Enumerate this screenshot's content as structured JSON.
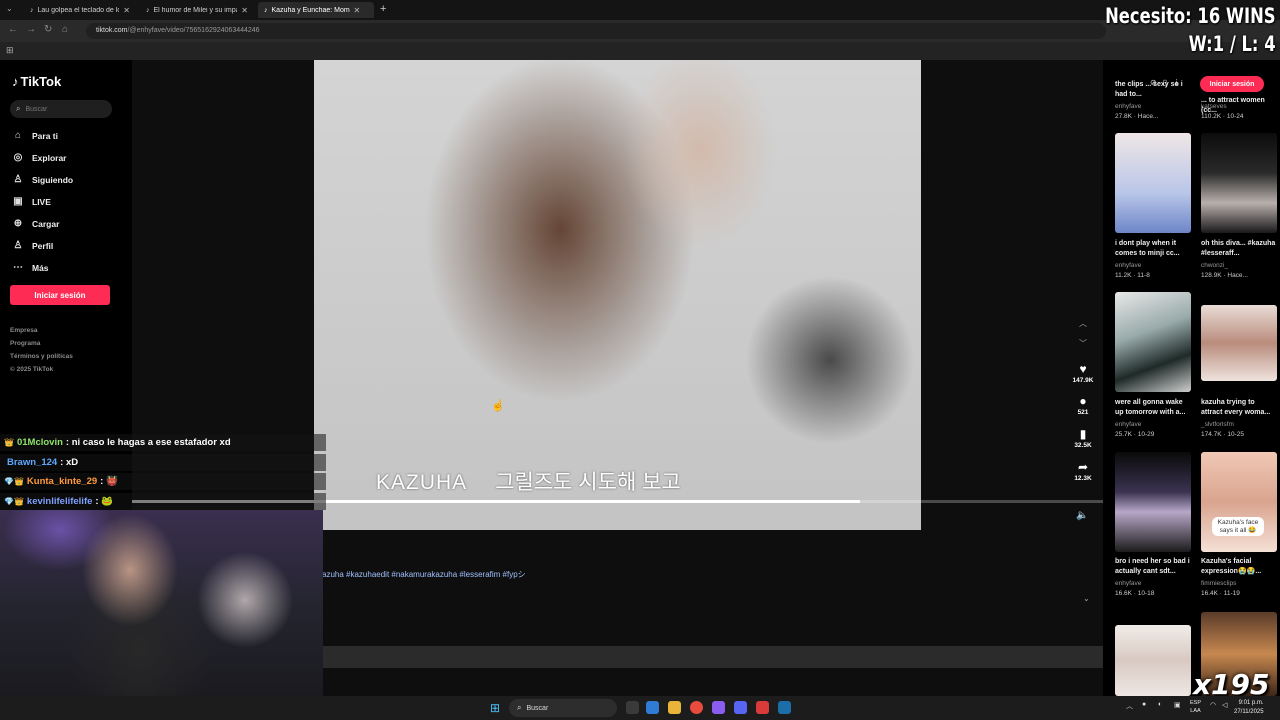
{
  "browser": {
    "tabs": [
      {
        "title": "Lau golpea el teclado de los lo"
      },
      {
        "title": "El humor de Milei y su impacto"
      },
      {
        "title": "Kazuha y Eunchae: Moment"
      }
    ],
    "new_tab": "+",
    "url_host": "tiktok.com",
    "url_path": "/@enhyfave/video/7565162924063444246"
  },
  "tiktok": {
    "logo": "TikTok",
    "search_placeholder": "Buscar",
    "nav": [
      {
        "label": "Para ti",
        "icon": "home-icon"
      },
      {
        "label": "Explorar",
        "icon": "compass-icon"
      },
      {
        "label": "Siguiendo",
        "icon": "following-icon"
      },
      {
        "label": "LIVE",
        "icon": "live-icon"
      },
      {
        "label": "Cargar",
        "icon": "upload-icon"
      },
      {
        "label": "Perfil",
        "icon": "profile-icon"
      },
      {
        "label": "Más",
        "icon": "more-icon"
      }
    ],
    "login": "Iniciar sesión",
    "footer": [
      "Empresa",
      "Programa",
      "Términos y políticas",
      "© 2025 TikTok"
    ]
  },
  "video": {
    "subtitle_name": "KAZUHA",
    "subtitle_korean": "그릴즈도 시도해 보고",
    "progress_fraction": 0.75,
    "likes": "147.9K",
    "comments": "521",
    "saves": "32.5K",
    "shares": "12.3K",
    "hashtags": "azuha #kazuhaedit #nakamurakazuha #lesserafim #fypシ"
  },
  "feed": {
    "login": "Iniciar sesión",
    "items": [
      {
        "caption": "the clips ... sexy so i had to...",
        "user": "enhyfave",
        "stats": "27.8K · Hace..."
      },
      {
        "caption": "... to attract women (cc...",
        "user": "katseves",
        "stats": "110.2K · 10-24"
      },
      {
        "caption": "i dont play when it comes to minji cc...",
        "user": "enhyfave",
        "stats": "11.2K · 11-8"
      },
      {
        "caption": "oh this diva... #kazuha #lesseraff...",
        "user": "chwonzi_",
        "stats": "128.9K · Hace..."
      },
      {
        "caption": "were all gonna wake up tomorrow with a...",
        "user": "enhyfave",
        "stats": "25.7K · 10-29"
      },
      {
        "caption": "kazuha trying to attract every woma...",
        "user": "_slvtforlsfm",
        "stats": "174.7K · 10-25"
      },
      {
        "caption": "bro i need her so bad i actually cant sdt...",
        "user": "enhyfave",
        "stats": "16.6K · 10-18"
      },
      {
        "caption": "Kazuha's facial expression😭😭...",
        "user": "fimmiesclips",
        "stats": "16.4K · 11-19"
      }
    ],
    "thumb_overlay": "Kazuha's face says it all 😂"
  },
  "stream": {
    "goal": "Necesito: 16 WINS",
    "record": "W:1 / L: 4",
    "multiplier": "x195",
    "chat": [
      {
        "badges": "👑",
        "user": "01Mclovin",
        "user_color": "#8fe36b",
        "message": ": ni caso le hagas a ese estafador xd"
      },
      {
        "badges": "",
        "user": "Brawn_124",
        "user_color": "#5fa8ff",
        "message": ": xD"
      },
      {
        "badges": "💎👑",
        "user": "Kunta_kinte_29",
        "user_color": "#ff9b3d",
        "message": ": 👹"
      },
      {
        "badges": "💎👑",
        "user": "kevinlifelifelife",
        "user_color": "#7fa0ff",
        "message": ": 🐸"
      }
    ]
  },
  "taskbar": {
    "search": "Buscar",
    "lang_line1": "ESP",
    "lang_line2": "LAA",
    "time": "9:01 p.m.",
    "date": "27/11/2025"
  }
}
